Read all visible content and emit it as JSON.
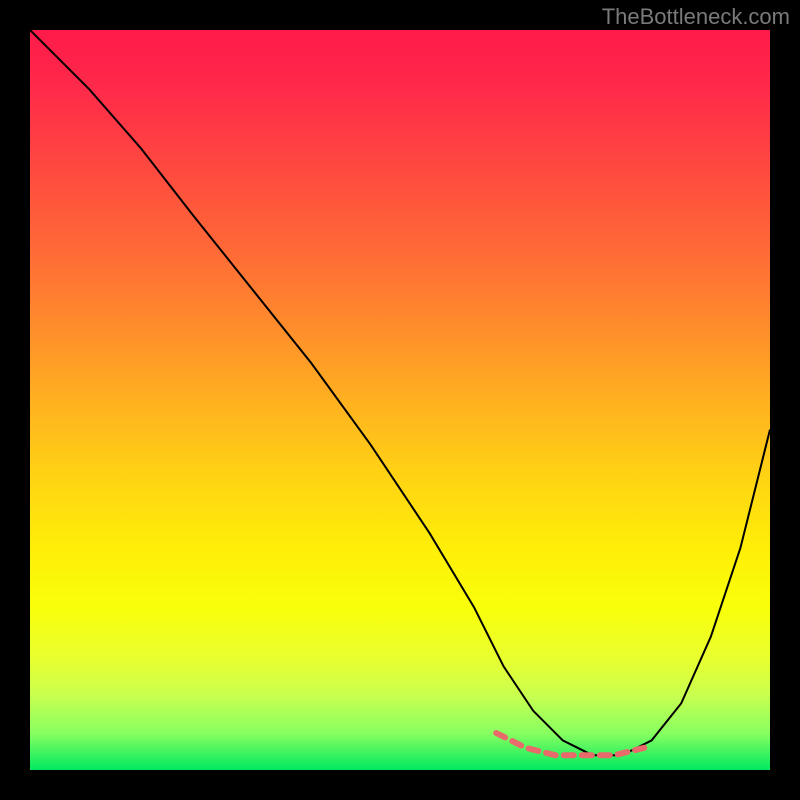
{
  "watermark": "TheBottleneck.com",
  "colors": {
    "background": "#000000",
    "curve": "#000000",
    "dotted_segment": "#e86a6a",
    "gradient_stops": [
      "#ff1a4a",
      "#ff4740",
      "#ff8c2c",
      "#ffd214",
      "#f9ff0a",
      "#00e860"
    ]
  },
  "chart_data": {
    "type": "line",
    "title": "",
    "xlabel": "",
    "ylabel": "",
    "xlim": [
      0,
      100
    ],
    "ylim": [
      0,
      100
    ],
    "grid": false,
    "series": [
      {
        "name": "bottleneck-curve",
        "x": [
          0,
          3,
          8,
          15,
          22,
          30,
          38,
          46,
          54,
          60,
          64,
          68,
          72,
          76,
          80,
          84,
          88,
          92,
          96,
          100
        ],
        "values": [
          100,
          97,
          92,
          84,
          75,
          65,
          55,
          44,
          32,
          22,
          14,
          8,
          4,
          2,
          2,
          4,
          9,
          18,
          30,
          46
        ]
      }
    ],
    "highlight_segment": {
      "name": "optimal-zone-dotted",
      "color": "#e86a6a",
      "x": [
        63,
        67,
        71,
        75,
        79,
        83
      ],
      "values": [
        5,
        3,
        2,
        2,
        2,
        3
      ]
    },
    "background_meaning": "vertical gradient from red (high bottleneck) to green (low bottleneck)"
  }
}
